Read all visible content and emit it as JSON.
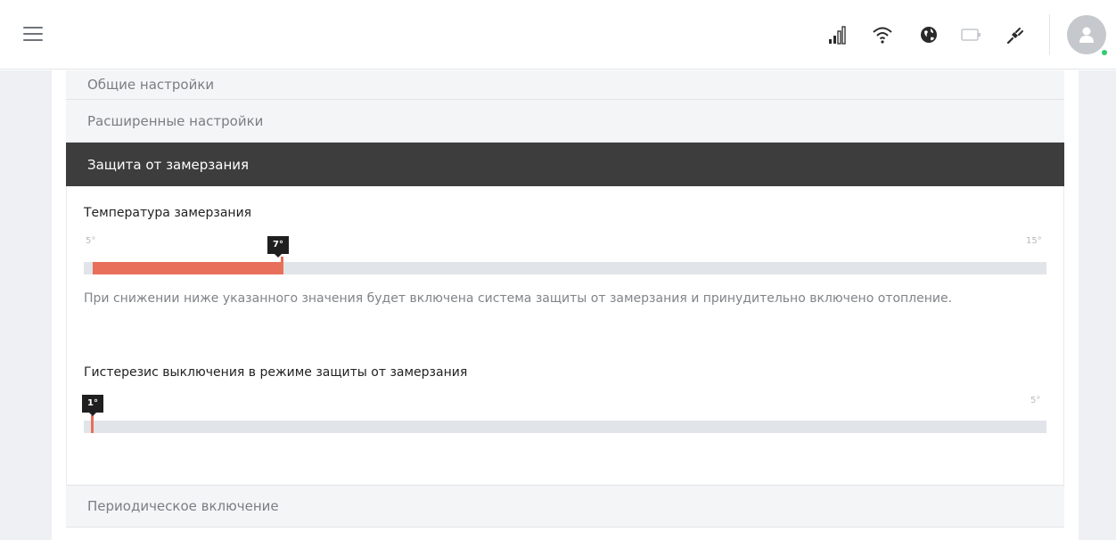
{
  "header": {
    "menu_icon": "hamburger-icon",
    "icons": [
      "signal-icon",
      "wifi-icon",
      "globe-icon",
      "battery-icon",
      "plug-icon"
    ],
    "avatar_icon": "user-avatar-icon",
    "online_status_color": "#2ecc71"
  },
  "accordion": {
    "general": "Общие настройки",
    "advanced": "Расширенные настройки",
    "freeze_protection": "Защита от замерзания",
    "periodic": "Периодическое включение"
  },
  "freeze_protection": {
    "temperature": {
      "label": "Температура замерзания",
      "min": "5°",
      "max": "15°",
      "value_label": "7°",
      "value": 7,
      "min_value": 5,
      "max_value": 15
    },
    "description": "При снижении ниже указанного значения будет включена система защиты от замерзания и принудительно включено отопление.",
    "hysteresis": {
      "label": "Гистерезис выключения в режиме защиты от замерзания",
      "max": "5°",
      "value_label": "1°",
      "value": 1,
      "min_value": 1,
      "max_value": 5
    }
  },
  "colors": {
    "accent": "#e8705a",
    "active_header": "#3d3d3d",
    "track": "#e1e4e8"
  }
}
